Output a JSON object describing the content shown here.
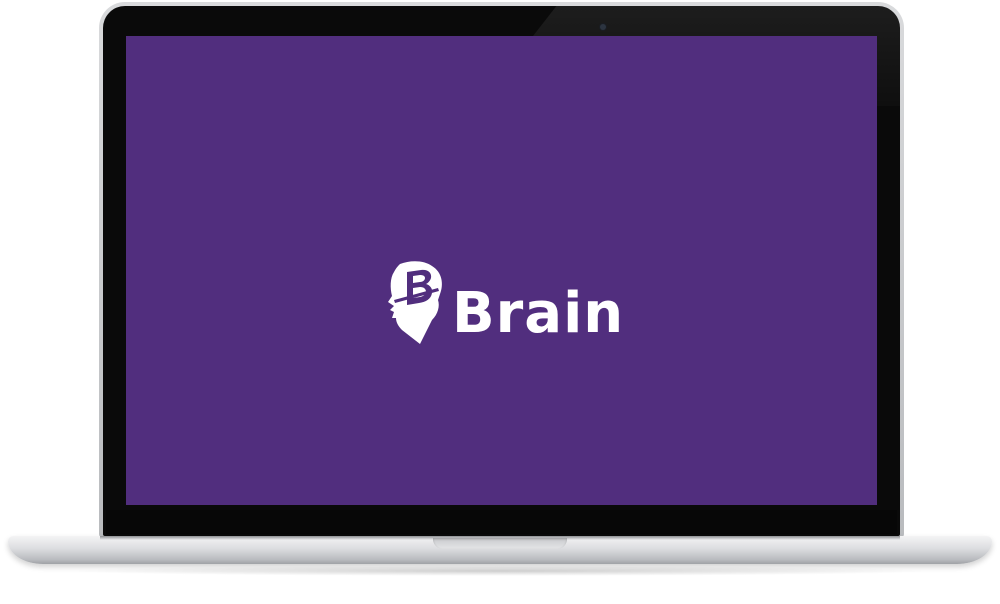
{
  "screen": {
    "background_color": "#512e7e",
    "logo": {
      "icon": "brain-head-icon",
      "text": "Brain",
      "color": "#ffffff"
    }
  }
}
